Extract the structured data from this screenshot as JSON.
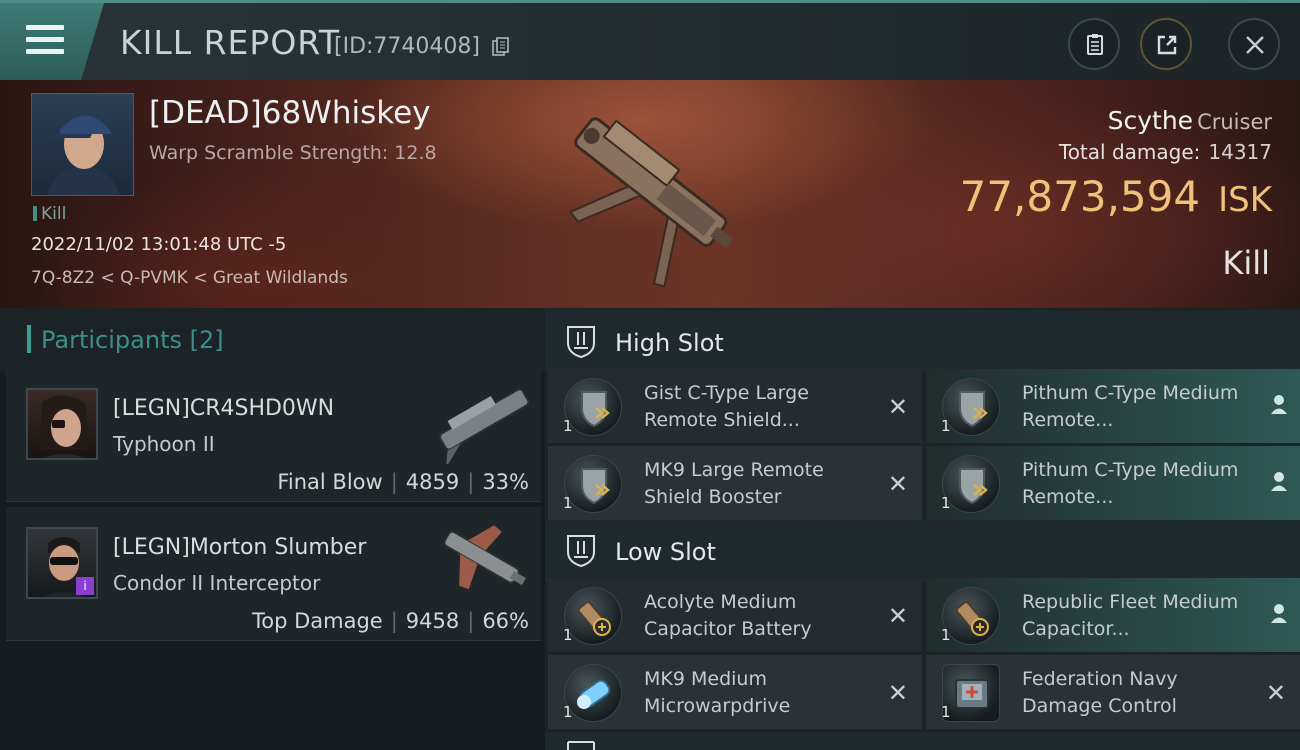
{
  "header": {
    "title": "KILL REPORT",
    "report_id": "[ID:7740408]"
  },
  "victim": {
    "name": "[DEAD]68Whiskey",
    "warp": "Warp Scramble Strength: 12.8",
    "tag": "Kill",
    "timestamp": "2022/11/02 13:01:48 UTC -5",
    "location": "7Q-8Z2 < Q-PVMK < Great Wildlands"
  },
  "ship": {
    "name": "Scythe",
    "class": "Cruiser",
    "damage_label": "Total damage:",
    "damage_value": "14317",
    "isk_value": "77,873,594",
    "isk_unit": "ISK",
    "result": "Kill"
  },
  "participants": {
    "title": "Participants [2]",
    "items": [
      {
        "name": "[LEGN]CR4SHD0WN",
        "ship": "Typhoon II",
        "role": "Final Blow",
        "damage": "4859",
        "percent": "33%"
      },
      {
        "name": "[LEGN]Morton Slumber",
        "ship": "Condor II Interceptor",
        "role": "Top Damage",
        "damage": "9458",
        "percent": "66%"
      }
    ]
  },
  "fitting": {
    "high_slot": {
      "title": "High Slot",
      "modules": [
        {
          "qty": "1",
          "name": "Gist C-Type Large Remote Shield..."
        },
        {
          "qty": "1",
          "name": "Pithum C-Type Medium Remote..."
        },
        {
          "qty": "1",
          "name": "MK9 Large Remote Shield Booster"
        },
        {
          "qty": "1",
          "name": "Pithum C-Type Medium Remote..."
        }
      ]
    },
    "low_slot": {
      "title": "Low Slot",
      "modules": [
        {
          "qty": "1",
          "name": "Acolyte Medium Capacitor Battery"
        },
        {
          "qty": "1",
          "name": "Republic Fleet Medium Capacitor..."
        },
        {
          "qty": "1",
          "name": "MK9 Medium Microwarpdrive"
        },
        {
          "qty": "1",
          "name": "Federation Navy Damage Control"
        }
      ]
    },
    "dropped_glyph": "✕"
  },
  "icons": {
    "menu": "hamburger-menu-icon",
    "copy": "copy-icon",
    "clipboard": "clipboard-icon",
    "share": "share-icon",
    "close": "close-icon",
    "slot": "slot-shield-icon",
    "owner": "person-icon"
  },
  "colors": {
    "accent": "#3b9d94",
    "isk": "#f0c178",
    "highlight_row": "#2f5955"
  }
}
